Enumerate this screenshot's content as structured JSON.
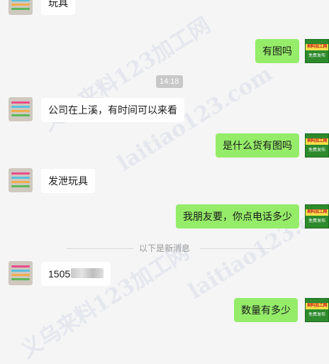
{
  "messages": [
    {
      "side": "left",
      "text": "玩具"
    },
    {
      "side": "right",
      "text": "有图吗"
    },
    {
      "side": "left",
      "text": "公司在上溪，有时间可以来看"
    },
    {
      "side": "right",
      "text": "是什么货有图吗"
    },
    {
      "side": "left",
      "text": "发泄玩具"
    },
    {
      "side": "right",
      "text": "我朋友要，你点电话多少"
    },
    {
      "side": "left",
      "text": "1505"
    },
    {
      "side": "right",
      "text": "数量有多少"
    }
  ],
  "timestamp": "14:18",
  "new_messages_divider": "以下是新消息",
  "right_avatar": {
    "top_text": "来料加工网",
    "bottom_text": "免费发布"
  },
  "watermarks": [
    "义乌来料123加工网",
    "laitiao123.com",
    "laitiao123.com",
    "义乌来料123加工网"
  ],
  "colors": {
    "background": "#f5f5f5",
    "left_bubble": "#ffffff",
    "right_bubble": "#95ec69"
  },
  "icons": {
    "left_avatar": "toy-photo-avatar",
    "right_avatar": "green-logo-avatar"
  }
}
